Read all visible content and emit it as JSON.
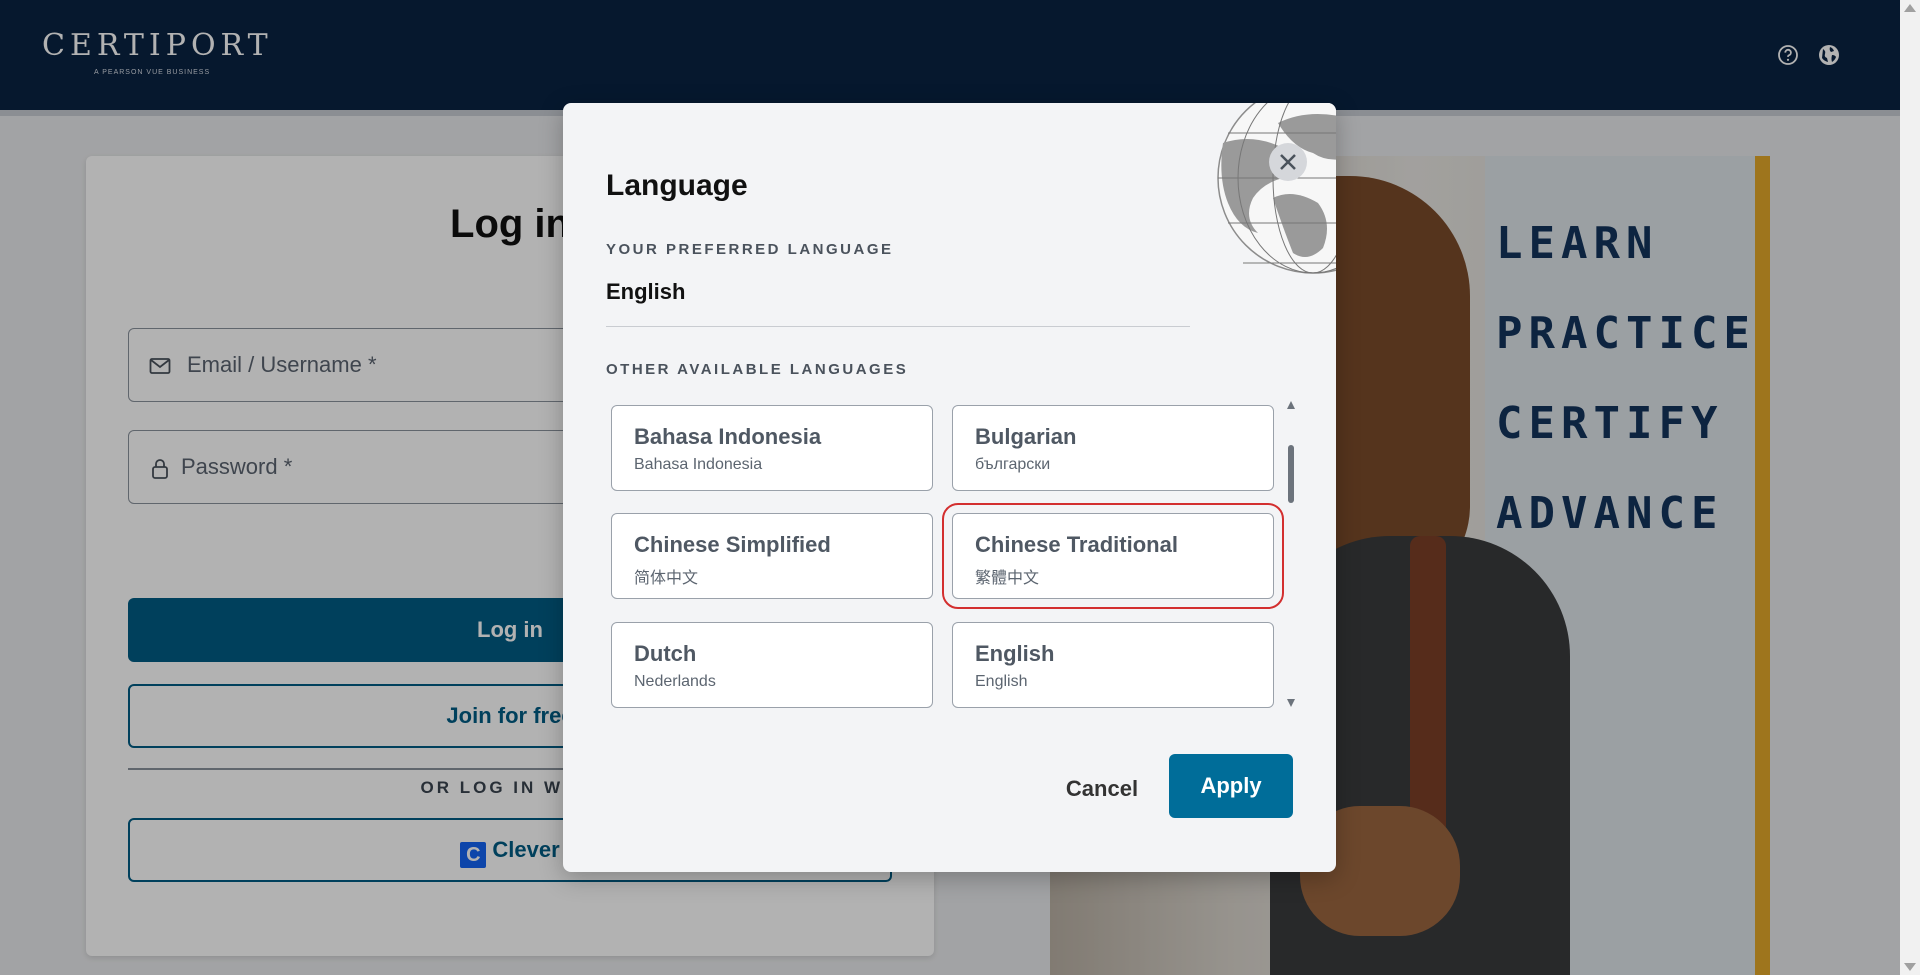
{
  "header": {
    "logo_text": "CERTIPORT",
    "logo_sub": "A PEARSON VUE BUSINESS",
    "icons": [
      "help-icon",
      "globe-icon"
    ]
  },
  "login": {
    "title": "Log in",
    "email_placeholder": "Email / Username  *",
    "password_placeholder": "Password *",
    "login_button": "Log in",
    "join_button": "Join for free",
    "or_text": "OR LOG IN WITH",
    "clever_button": "Clever"
  },
  "hero": {
    "words": [
      "LEARN",
      "PRACTICE",
      "CERTIFY",
      "ADVANCE"
    ],
    "accent_color": "#e3a82a"
  },
  "dialog": {
    "title": "Language",
    "preferred_label": "YOUR PREFERRED LANGUAGE",
    "preferred_value": "English",
    "other_label": "OTHER AVAILABLE LANGUAGES",
    "languages": [
      {
        "name": "Bahasa Indonesia",
        "native": "Bahasa Indonesia"
      },
      {
        "name": "Bulgarian",
        "native": "български"
      },
      {
        "name": "Chinese Simplified",
        "native": "简体中文"
      },
      {
        "name": "Chinese Traditional",
        "native": "繁體中文"
      },
      {
        "name": "Dutch",
        "native": "Nederlands"
      },
      {
        "name": "English",
        "native": "English"
      }
    ],
    "highlighted_language": "Chinese Traditional",
    "cancel_label": "Cancel",
    "apply_label": "Apply"
  },
  "colors": {
    "header_bg": "#0a2342",
    "primary": "#005c84",
    "apply": "#006d99",
    "highlight": "#d32f2f"
  }
}
